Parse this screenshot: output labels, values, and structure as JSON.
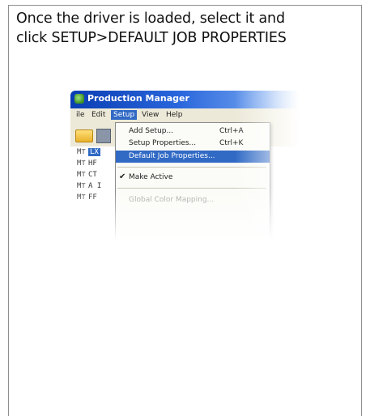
{
  "instruction": {
    "line1": "Once the driver is loaded, select it and",
    "line2": "click SETUP>DEFAULT JOB PROPERTIES"
  },
  "app": {
    "title": "Production Manager",
    "menu": [
      "ile",
      "Edit",
      "Setup",
      "View",
      "Help"
    ],
    "selected_menu": "Setup",
    "tree_rows": [
      {
        "prefix": "M",
        "label": "LX"
      },
      {
        "prefix": "M",
        "label": "HF"
      },
      {
        "prefix": "M",
        "label": "CT"
      },
      {
        "prefix": "M",
        "label": "A I"
      },
      {
        "prefix": "M",
        "label": "FF"
      }
    ],
    "setup_menu": {
      "add_setup": {
        "label": "Add Setup...",
        "shortcut": "Ctrl+A"
      },
      "setup_properties": {
        "label": "Setup Properties...",
        "shortcut": "Ctrl+K"
      },
      "default_job_properties": {
        "label": "Default Job Properties..."
      },
      "make_active": {
        "label": "Make Active",
        "checked": true
      },
      "global_color_mapping": {
        "label": "Global Color Mapping...",
        "disabled": true
      }
    }
  },
  "colors": {
    "title_bar": "#2a67dc",
    "highlight": "#316ac5",
    "menu_bg": "#ece9d8",
    "frame_border": "#8f8f8f"
  }
}
